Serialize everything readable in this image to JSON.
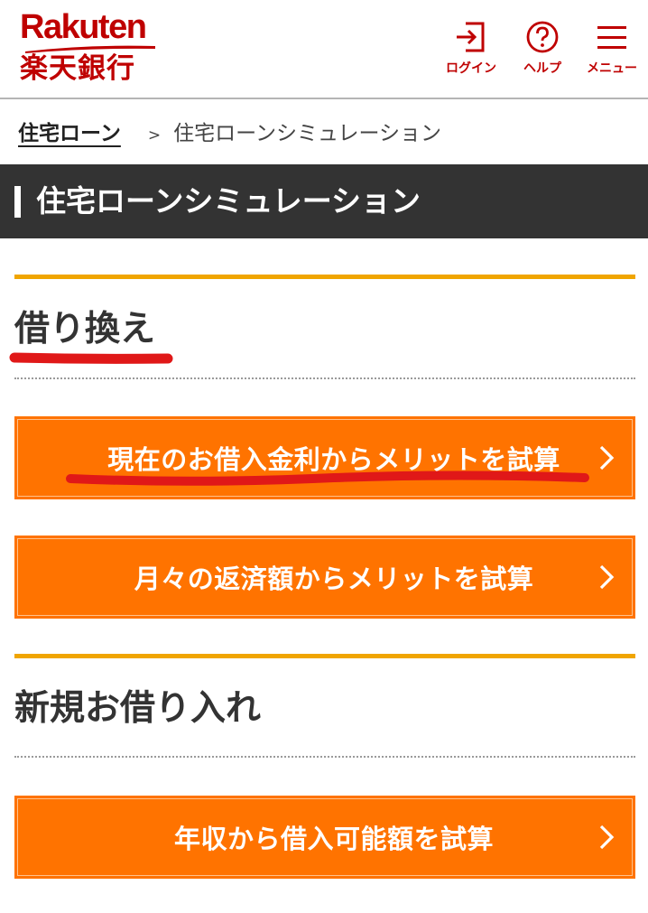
{
  "header": {
    "logo_en": "Rakuten",
    "logo_jp": "楽天銀行",
    "login_label": "ログイン",
    "help_label": "ヘルプ",
    "menu_label": "メニュー"
  },
  "breadcrumb": {
    "parent": "住宅ローン",
    "separator": ">",
    "current": "住宅ローンシミュレーション"
  },
  "page_title": "住宅ローンシミュレーション",
  "sections": [
    {
      "heading": "借り換え",
      "buttons": [
        {
          "label": "現在のお借入金利からメリットを試算"
        },
        {
          "label": "月々の返済額からメリットを試算"
        }
      ]
    },
    {
      "heading": "新規お借り入れ",
      "buttons": [
        {
          "label": "年収から借入可能額を試算"
        }
      ]
    }
  ],
  "colors": {
    "brand_red": "#bf0000",
    "cta_orange": "#ff7300",
    "section_accent": "#f0a500",
    "title_bar": "#333333",
    "annotation_red": "#e01818"
  },
  "icons": {
    "login": "login-icon",
    "help": "question-circle-icon",
    "menu": "hamburger-icon",
    "arrow": "chevron-right-icon"
  }
}
